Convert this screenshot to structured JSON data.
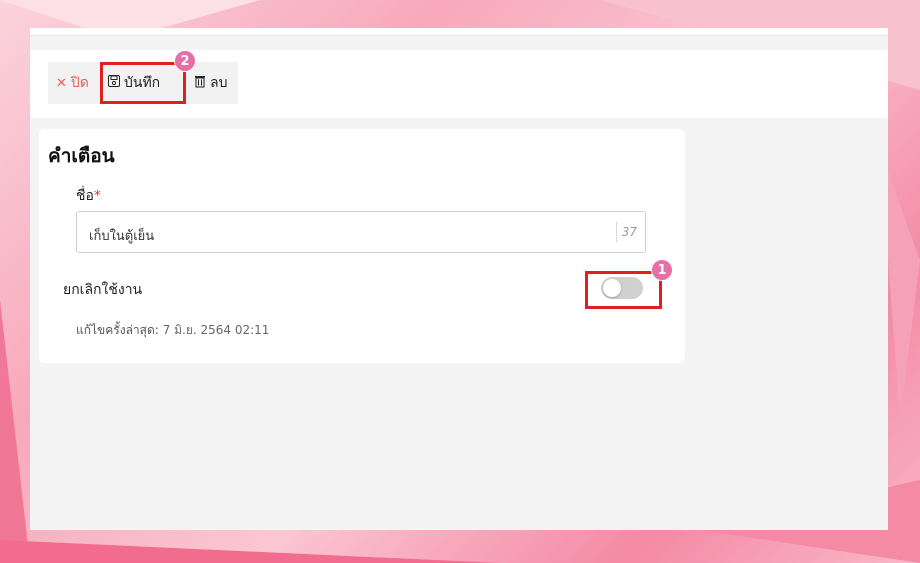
{
  "toolbar": {
    "close_label": "ปิด",
    "save_label": "บันทึก",
    "delete_label": "ลบ"
  },
  "card": {
    "title": "คำเตือน",
    "name_label": "ชื่อ",
    "required_mark": "*",
    "name_value": "เก็บในตู้เย็น",
    "name_remaining": "37",
    "disable_label": "ยกเลิกใช้งาน",
    "disable_enabled": false,
    "updated_label": "แก้ไขครั้งล่าสุด:",
    "updated_value": "7 มิ.ย. 2564 02:11"
  },
  "annotations": {
    "step1": "1",
    "step2": "2",
    "highlight_color": "#e0201e",
    "badge_color": "#e66fa8"
  }
}
